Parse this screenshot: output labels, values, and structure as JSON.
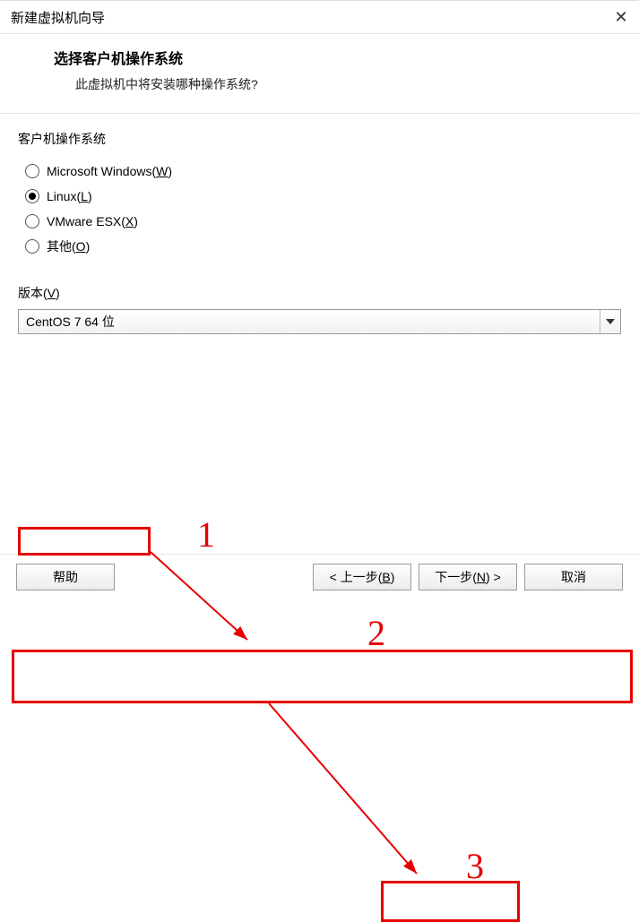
{
  "window": {
    "title": "新建虚拟机向导"
  },
  "header": {
    "title": "选择客户机操作系统",
    "subtitle": "此虚拟机中将安装哪种操作系统?"
  },
  "group": {
    "title": "客户机操作系统",
    "options": {
      "windows": "Microsoft Windows(<u>W</u>)",
      "linux": "Linux(<u>L</u>)",
      "vmwareesx": "VMware ESX(<u>X</u>)",
      "other": "其他(<u>O</u>)"
    },
    "selected": "linux"
  },
  "version": {
    "label": "版本(<u>V</u>)",
    "value": "CentOS 7 64 位"
  },
  "buttons": {
    "help": "帮助",
    "back": "< 上一步(<u>B</u>)",
    "next": "下一步(<u>N</u>) >",
    "cancel": "取消"
  },
  "annotations": {
    "n1": "1",
    "n2": "2",
    "n3": "3"
  }
}
